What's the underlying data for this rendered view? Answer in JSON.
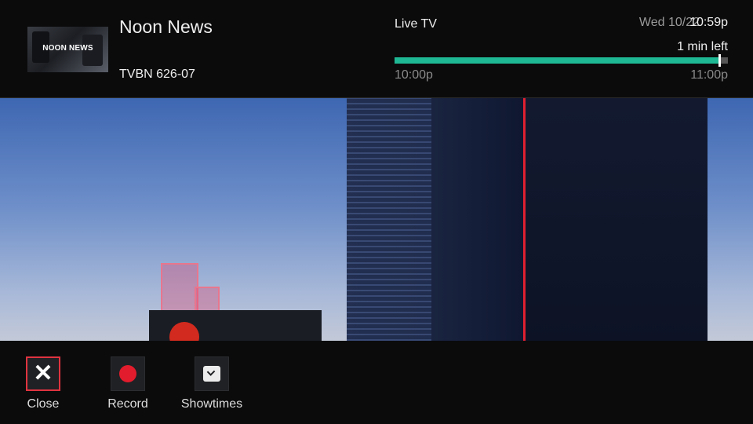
{
  "program": {
    "title": "Noon News",
    "channel": "TVBN 626-07",
    "thumbnail_text": "NOON NEWS"
  },
  "status": {
    "source": "Live TV",
    "date": "Wed 10/22",
    "time": "10:59p",
    "remaining": "1 min left",
    "start_time": "10:00p",
    "end_time": "11:00p",
    "progress_fraction": 0.974
  },
  "actions": [
    {
      "label": "Close",
      "icon": "close-icon"
    },
    {
      "label": "Record",
      "icon": "record-icon"
    },
    {
      "label": "Showtimes",
      "icon": "clock-icon"
    }
  ],
  "colors": {
    "progress": "#1fb894",
    "focus": "#e0333f",
    "record": "#e21c2c"
  }
}
